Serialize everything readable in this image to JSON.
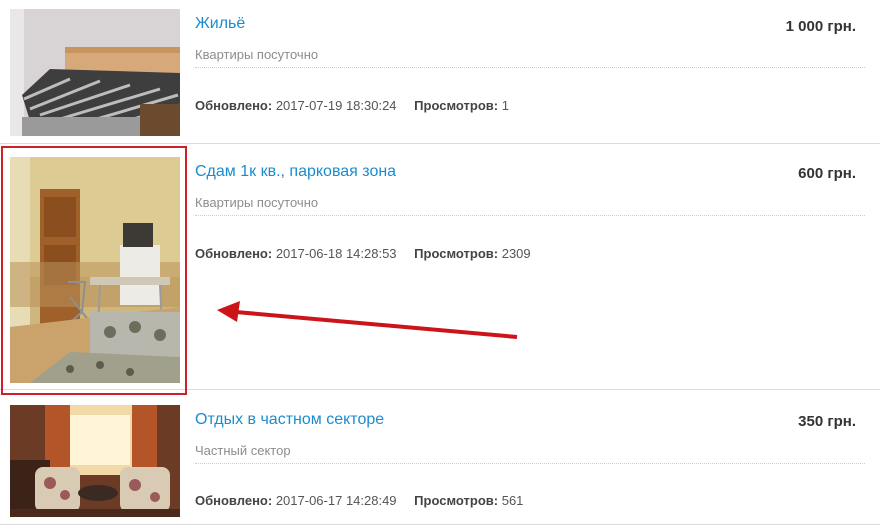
{
  "listings": [
    {
      "title": "Жильё",
      "category": "Квартиры посуточно",
      "price": "1 000 грн.",
      "updated_label": "Обновлено:",
      "updated_value": "2017-07-19 18:30:24",
      "views_label": "Просмотров:",
      "views_value": "1"
    },
    {
      "title": "Сдам 1к кв., парковая зона",
      "category": "Квартиры посуточно",
      "price": "600 грн.",
      "updated_label": "Обновлено:",
      "updated_value": "2017-06-18 14:28:53",
      "views_label": "Просмотров:",
      "views_value": "2309"
    },
    {
      "title": "Отдых в частном секторе",
      "category": "Частный сектор",
      "price": "350 грн.",
      "updated_label": "Обновлено:",
      "updated_value": "2017-06-17 14:28:49",
      "views_label": "Просмотров:",
      "views_value": "561"
    }
  ],
  "colors": {
    "link": "#1a8ccf",
    "highlight": "#cf2027",
    "arrow": "#cc1419"
  }
}
